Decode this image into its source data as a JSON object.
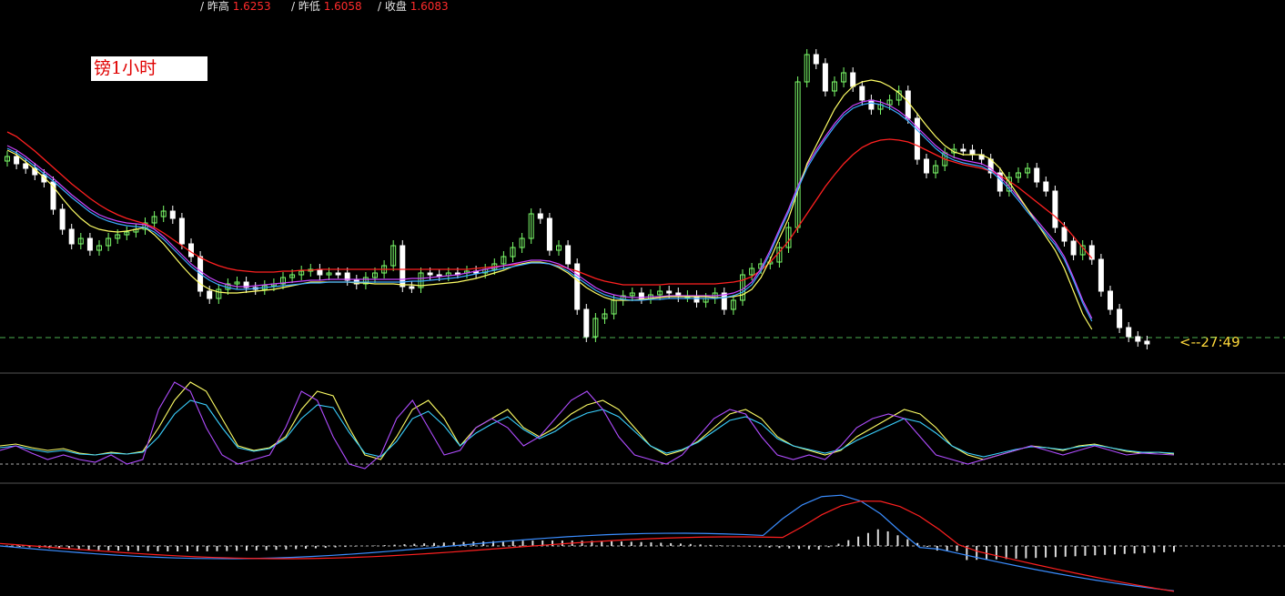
{
  "header": {
    "items": [
      {
        "label": "/ 昨高",
        "value": "1.6253"
      },
      {
        "label": "/ 昨低",
        "value": "1.6058"
      },
      {
        "label": "/ 收盘",
        "value": "1.6083"
      }
    ]
  },
  "chart_label": "镑1小时",
  "countdown": "<--27:49",
  "colors": {
    "bull": "#7CFC6A",
    "bear": "#ffffff",
    "ma_fast": "#ffff66",
    "ma_cyan": "#3aa8ff",
    "ma_purple": "#cc44ff",
    "ma_red": "#ff2020",
    "grid": "#3a3a3a"
  },
  "chart_data": [
    {
      "type": "candlestick",
      "panel": "price",
      "title": "",
      "candle_closes": [
        172,
        180,
        185,
        192,
        200,
        230,
        252,
        268,
        262,
        275,
        270,
        262,
        258,
        255,
        252,
        245,
        238,
        232,
        240,
        268,
        282,
        320,
        328,
        318,
        312,
        310,
        316,
        318,
        314,
        312,
        305,
        302,
        298,
        296,
        302,
        300,
        300,
        308,
        312,
        305,
        300,
        292,
        270,
        315,
        316,
        300,
        302,
        303,
        300,
        300,
        298,
        300,
        296,
        290,
        282,
        272,
        262,
        235,
        240,
        275,
        270,
        290,
        340,
        370,
        350,
        345,
        330,
        325,
        322,
        328,
        324,
        320,
        322,
        326,
        325,
        332,
        328,
        322,
        340,
        330,
        302,
        295,
        290,
        288,
        272,
        250,
        90,
        60,
        70,
        100,
        90,
        80,
        95,
        110,
        120,
        115,
        110,
        100,
        130,
        175,
        190,
        182,
        168,
        164,
        165,
        170,
        175,
        190,
        210,
        195,
        190,
        185,
        200,
        210,
        250,
        265,
        280,
        270,
        285,
        320,
        340,
        360,
        370,
        375,
        378
      ],
      "fast_ma": [
        165,
        170,
        178,
        186,
        195,
        205,
        218,
        230,
        240,
        248,
        252,
        254,
        255,
        254,
        252,
        250,
        258,
        268,
        280,
        292,
        303,
        312,
        318,
        321,
        322,
        322,
        321,
        320,
        319,
        318,
        316,
        314,
        312,
        310,
        310,
        310,
        310,
        310,
        311,
        311,
        312,
        312,
        312,
        313,
        313,
        314,
        313,
        312,
        311,
        310,
        308,
        306,
        303,
        300,
        297,
        293,
        290,
        288,
        288,
        290,
        294,
        300,
        308,
        316,
        322,
        327,
        330,
        330,
        330,
        329,
        328,
        327,
        326,
        326,
        326,
        326,
        326,
        327,
        327,
        326,
        324,
        318,
        305,
        285,
        262,
        240,
        210,
        180,
        160,
        140,
        120,
        105,
        95,
        90,
        88,
        90,
        95,
        102,
        112,
        125,
        138,
        150,
        160,
        167,
        170,
        170,
        170,
        175,
        185,
        200,
        215,
        230,
        245,
        260,
        275,
        295,
        320,
        345,
        362
      ],
      "middle_ma": [
        160,
        165,
        172,
        180,
        188,
        196,
        205,
        214,
        222,
        230,
        236,
        240,
        243,
        245,
        246,
        247,
        252,
        260,
        270,
        280,
        290,
        298,
        305,
        310,
        313,
        315,
        315,
        314,
        313,
        312,
        311,
        310,
        309,
        308,
        308,
        307,
        307,
        307,
        307,
        307,
        307,
        307,
        307,
        307,
        306,
        306,
        305,
        304,
        303,
        302,
        300,
        298,
        296,
        294,
        292,
        290,
        288,
        286,
        286,
        287,
        290,
        295,
        302,
        309,
        316,
        321,
        324,
        326,
        327,
        327,
        326,
        326,
        325,
        325,
        325,
        325,
        325,
        325,
        324,
        322,
        318,
        310,
        295,
        275,
        252,
        230,
        205,
        182,
        165,
        150,
        136,
        124,
        116,
        112,
        110,
        112,
        116,
        122,
        130,
        140,
        150,
        160,
        168,
        173,
        176,
        178,
        180,
        185,
        194,
        205,
        217,
        230,
        242,
        254,
        266,
        282,
        305,
        330,
        350
      ],
      "slow_ma": [
        145,
        150,
        158,
        166,
        175,
        184,
        193,
        202,
        210,
        218,
        225,
        231,
        236,
        240,
        243,
        246,
        250,
        256,
        263,
        270,
        277,
        283,
        288,
        292,
        295,
        297,
        298,
        299,
        299,
        299,
        298,
        298,
        297,
        297,
        296,
        296,
        296,
        296,
        296,
        296,
        296,
        296,
        296,
        296,
        296,
        296,
        296,
        296,
        296,
        296,
        296,
        295,
        294,
        293,
        292,
        291,
        290,
        289,
        289,
        290,
        292,
        295,
        298,
        302,
        306,
        309,
        311,
        313,
        313,
        313,
        313,
        313,
        312,
        312,
        312,
        312,
        312,
        312,
        311,
        310,
        308,
        304,
        297,
        288,
        277,
        265,
        250,
        235,
        220,
        205,
        192,
        180,
        170,
        162,
        157,
        154,
        153,
        154,
        156,
        160,
        165,
        170,
        175,
        178,
        181,
        183,
        185,
        188,
        193,
        199,
        206,
        214,
        222,
        230,
        238,
        248,
        260,
        272,
        284
      ]
    },
    {
      "type": "line",
      "panel": "oscillator",
      "title": "",
      "series": [
        {
          "name": "",
          "values": [
            490,
            488,
            492,
            495,
            493,
            498,
            500,
            497,
            499,
            496,
            470,
            440,
            420,
            430,
            460,
            490,
            495,
            492,
            480,
            450,
            430,
            435,
            470,
            500,
            505,
            480,
            450,
            440,
            460,
            490,
            470,
            460,
            450,
            470,
            480,
            470,
            455,
            445,
            440,
            450,
            470,
            490,
            500,
            495,
            485,
            470,
            455,
            450,
            460,
            480,
            490,
            495,
            500,
            495,
            480,
            470,
            460,
            450,
            455,
            470,
            490,
            500,
            505,
            500,
            495,
            490,
            492,
            495,
            490,
            488,
            492,
            496,
            498,
            497,
            499
          ]
        },
        {
          "name": "",
          "values": [
            492,
            490,
            494,
            497,
            495,
            499,
            500,
            498,
            499,
            497,
            480,
            455,
            440,
            445,
            470,
            492,
            496,
            493,
            482,
            460,
            445,
            448,
            475,
            498,
            502,
            485,
            460,
            452,
            468,
            490,
            476,
            466,
            458,
            472,
            482,
            474,
            462,
            454,
            450,
            458,
            474,
            490,
            498,
            494,
            486,
            474,
            462,
            458,
            466,
            482,
            490,
            494,
            498,
            494,
            484,
            476,
            468,
            460,
            464,
            476,
            490,
            498,
            502,
            498,
            494,
            491,
            492,
            494,
            491,
            489,
            492,
            495,
            497,
            497,
            498
          ]
        },
        {
          "name": "",
          "values": [
            495,
            490,
            498,
            505,
            500,
            505,
            508,
            500,
            510,
            505,
            450,
            420,
            430,
            470,
            500,
            510,
            505,
            500,
            470,
            430,
            440,
            480,
            510,
            515,
            500,
            460,
            440,
            470,
            500,
            495,
            470,
            460,
            470,
            490,
            480,
            460,
            440,
            430,
            450,
            480,
            500,
            505,
            510,
            500,
            480,
            460,
            450,
            455,
            480,
            500,
            505,
            500,
            505,
            490,
            470,
            460,
            455,
            460,
            480,
            500,
            505,
            510,
            505,
            500,
            495,
            490,
            495,
            500,
            495,
            490,
            495,
            500,
            498,
            499,
            500
          ]
        }
      ]
    },
    {
      "type": "bar",
      "panel": "macd",
      "title": "",
      "values": [
        0,
        0,
        0,
        0,
        0,
        0,
        0,
        0,
        0,
        0,
        0,
        0,
        0,
        0,
        0,
        0,
        0,
        0,
        0,
        0,
        0,
        0,
        0,
        0,
        0,
        0,
        0,
        0,
        0,
        0,
        0,
        0,
        0,
        0,
        0,
        0,
        0,
        0,
        0,
        0,
        0,
        0,
        0,
        0,
        0,
        0,
        0,
        0,
        0,
        0,
        0,
        0,
        0,
        0,
        0,
        0,
        0,
        0,
        0,
        0,
        0,
        0,
        0,
        0,
        0,
        0,
        0,
        0,
        0,
        0,
        0,
        0,
        0,
        0,
        0,
        0,
        0,
        0,
        0,
        0,
        0,
        0,
        0,
        0,
        0,
        0,
        0,
        0,
        0,
        0,
        0,
        0,
        0,
        0,
        0,
        0,
        0,
        0,
        0,
        0,
        0,
        0,
        0,
        0,
        0,
        0,
        0,
        0,
        0,
        0,
        0,
        0,
        0,
        0,
        0,
        0,
        0,
        0,
        0,
        0
      ]
    }
  ]
}
